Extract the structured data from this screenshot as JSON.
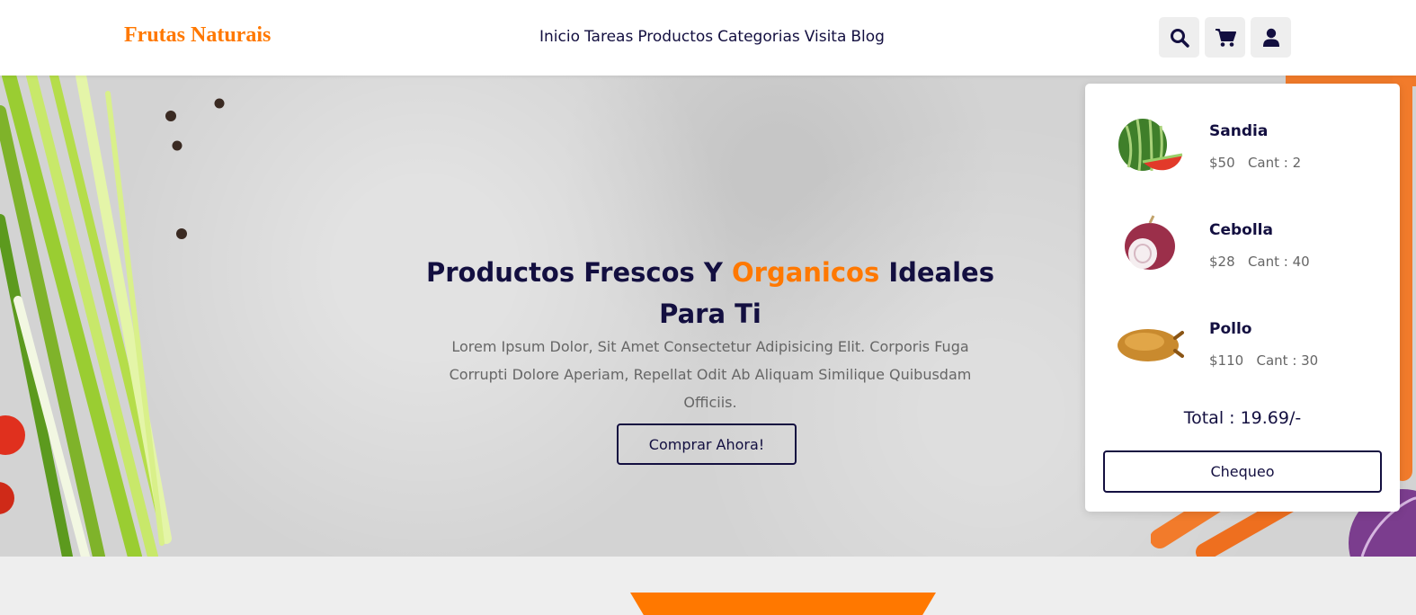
{
  "brand": {
    "name": "Frutas Naturais"
  },
  "nav": {
    "items": [
      "Inicio",
      "Tareas",
      "Productos",
      "Categorias",
      "Visita",
      "Blog"
    ]
  },
  "header_icons": [
    "search-icon",
    "cart-icon",
    "user-icon"
  ],
  "hero": {
    "title_part1": "Productos Frescos Y ",
    "title_accent": "Organicos",
    "title_part2": " Ideales Para Ti",
    "description": "Lorem Ipsum Dolor, Sit Amet Consectetur Adipisicing Elit. Corporis Fuga Corrupti Dolore Aperiam, Repellat Odit Ab Aliquam Similique Quibusdam Officiis.",
    "button_label": "Comprar Ahora!"
  },
  "cart": {
    "items": [
      {
        "name": "Sandia",
        "price": "$50",
        "qty": "Cant : 2",
        "image": "watermelon"
      },
      {
        "name": "Cebolla",
        "price": "$28",
        "qty": "Cant : 40",
        "image": "onion"
      },
      {
        "name": "Pollo",
        "price": "$110",
        "qty": "Cant : 30",
        "image": "roast-chicken"
      }
    ],
    "total": "Total : 19.69/-",
    "checkout_label": "Chequeo"
  },
  "colors": {
    "accent": "#ff7800",
    "primary": "#130f40",
    "text_muted": "#666666",
    "background": "#eeeeee"
  }
}
